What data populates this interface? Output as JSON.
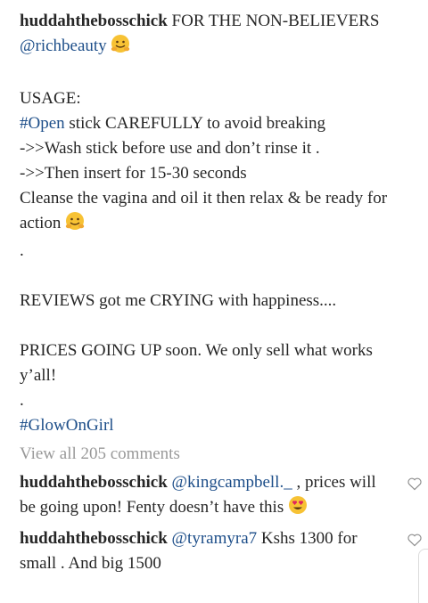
{
  "caption": {
    "username": "huddahthebosschick",
    "text1": "FOR THE NON-BELIEVERS",
    "mention": "@richbeauty",
    "usage_heading": "USAGE:",
    "hashtag_open": "#Open",
    "line1_rest": "stick CAREFULLY to avoid breaking",
    "line2": "->>Wash stick before use and don’t rinse it .",
    "line3": "->>Then insert for 15-30 seconds",
    "line4": "Cleanse the vagina and oil it then relax & be ready for action",
    "dot1": ".",
    "reviews": "REVIEWS got me CRYING with happiness....",
    "prices": "PRICES GOING UP soon. We only sell what works y’all!",
    "dot2": ".",
    "hashtag_glow": "#GlowOnGirl"
  },
  "view_all_comments": "View all 205 comments",
  "comments": [
    {
      "username": "huddahthebosschick",
      "mention": "@kingcampbell._",
      "text": ", prices will be going upon! Fenty doesn’t have this"
    },
    {
      "username": "huddahthebosschick",
      "mention": "@tyramyra7",
      "text": "Kshs 1300 for small . And big 1500"
    }
  ],
  "icons": {
    "hug": "hugging-face-emoji",
    "heart_eyes": "heart-eyes-emoji",
    "like": "heart-outline-icon"
  }
}
